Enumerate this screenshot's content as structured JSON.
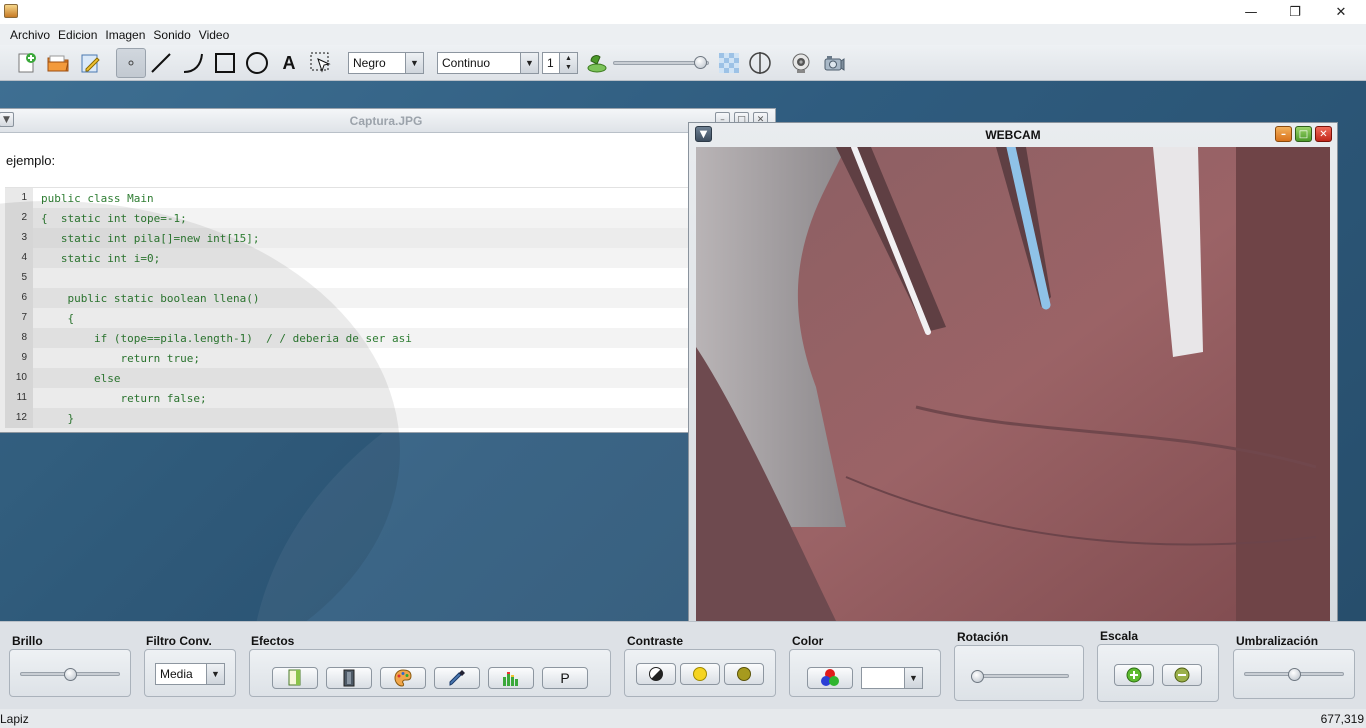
{
  "menubar": {
    "items": [
      "Archivo",
      "Edicion",
      "Imagen",
      "Sonido",
      "Video"
    ]
  },
  "window_controls": {
    "minimize": "—",
    "restore": "❐",
    "close": "✕"
  },
  "toolbar": {
    "color_select": "Negro",
    "stroke_select": "Continuo",
    "thickness_spinner": "1",
    "text_tool_label": "A"
  },
  "image_frame": {
    "title": "Captura.JPG",
    "caption": "ejemplo:",
    "code_lines": [
      {
        "n": "1",
        "text": "public class Main"
      },
      {
        "n": "2",
        "text": "{  static int tope=-1;"
      },
      {
        "n": "3",
        "text": "   static int pila[]=new int[15];"
      },
      {
        "n": "4",
        "text": "   static int i=0;"
      },
      {
        "n": "5",
        "text": ""
      },
      {
        "n": "6",
        "text": "    public static boolean llena()"
      },
      {
        "n": "7",
        "text": "    {"
      },
      {
        "n": "8",
        "text": "        if (tope==pila.length-1)  / / deberia de ser asi"
      },
      {
        "n": "9",
        "text": "            return true;"
      },
      {
        "n": "10",
        "text": "        else"
      },
      {
        "n": "11",
        "text": "            return false;"
      },
      {
        "n": "12",
        "text": "    }"
      }
    ]
  },
  "webcam_frame": {
    "title": "WEBCAM"
  },
  "bottom_panel": {
    "brillo": {
      "label": "Brillo",
      "level": 0.5
    },
    "filtro": {
      "label": "Filtro Conv.",
      "value": "Media"
    },
    "efectos": {
      "label": "Efectos",
      "p_button": "P"
    },
    "contraste": {
      "label": "Contraste"
    },
    "color": {
      "label": "Color",
      "select_value": ""
    },
    "rotacion": {
      "label": "Rotación",
      "level": 0.0
    },
    "escala": {
      "label": "Escala"
    },
    "umbralizacion": {
      "label": "Umbralización",
      "level": 0.5
    }
  },
  "toolbar_slider_level": 0.97,
  "status": {
    "tool": "Lapiz",
    "coords": "677,319"
  }
}
